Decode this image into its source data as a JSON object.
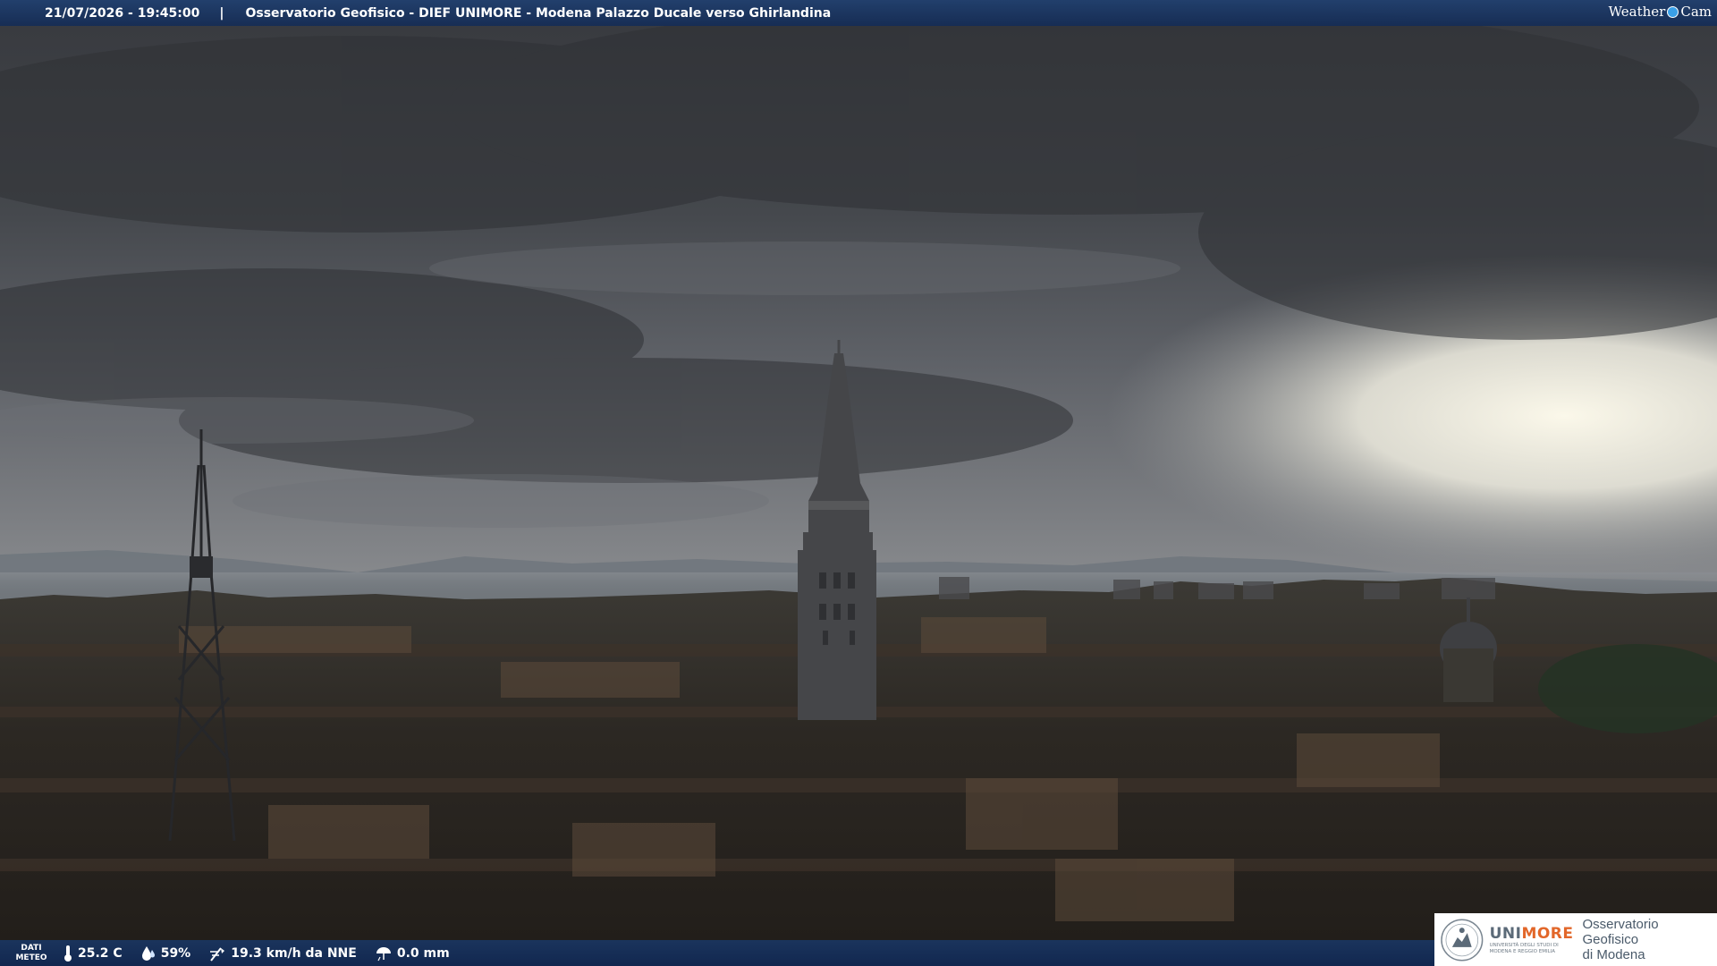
{
  "header": {
    "datetime": "21/07/2026 - 19:45:00",
    "separator": "|",
    "title": "Osservatorio Geofisico - DIEF UNIMORE - Modena Palazzo Ducale verso Ghirlandina",
    "brand_left": "Weather",
    "brand_right": "Cam"
  },
  "weather": {
    "label_line1": "DATI",
    "label_line2": "METEO",
    "temperature": "25.2 C",
    "humidity": "59%",
    "wind": "19.3 km/h da NNE",
    "rain": "0.0 mm",
    "icons": [
      "thermometer-icon",
      "humidity-drop-icon",
      "wind-icon",
      "rain-icon"
    ]
  },
  "logo": {
    "uni": "UNI",
    "more": "MORE",
    "university_line": "UNIVERSITÀ DEGLI STUDI DI MODENA E REGGIO EMILIA",
    "observatory_line1": "Osservatorio Geofisico",
    "observatory_line2": "di Modena"
  },
  "colors": {
    "header_bar": "#1e3e72",
    "unimore_orange": "#e2672a",
    "unimore_grey": "#5b6a78",
    "sky_dark": "#3a3d42",
    "sky_bright": "#f4f2e6"
  }
}
